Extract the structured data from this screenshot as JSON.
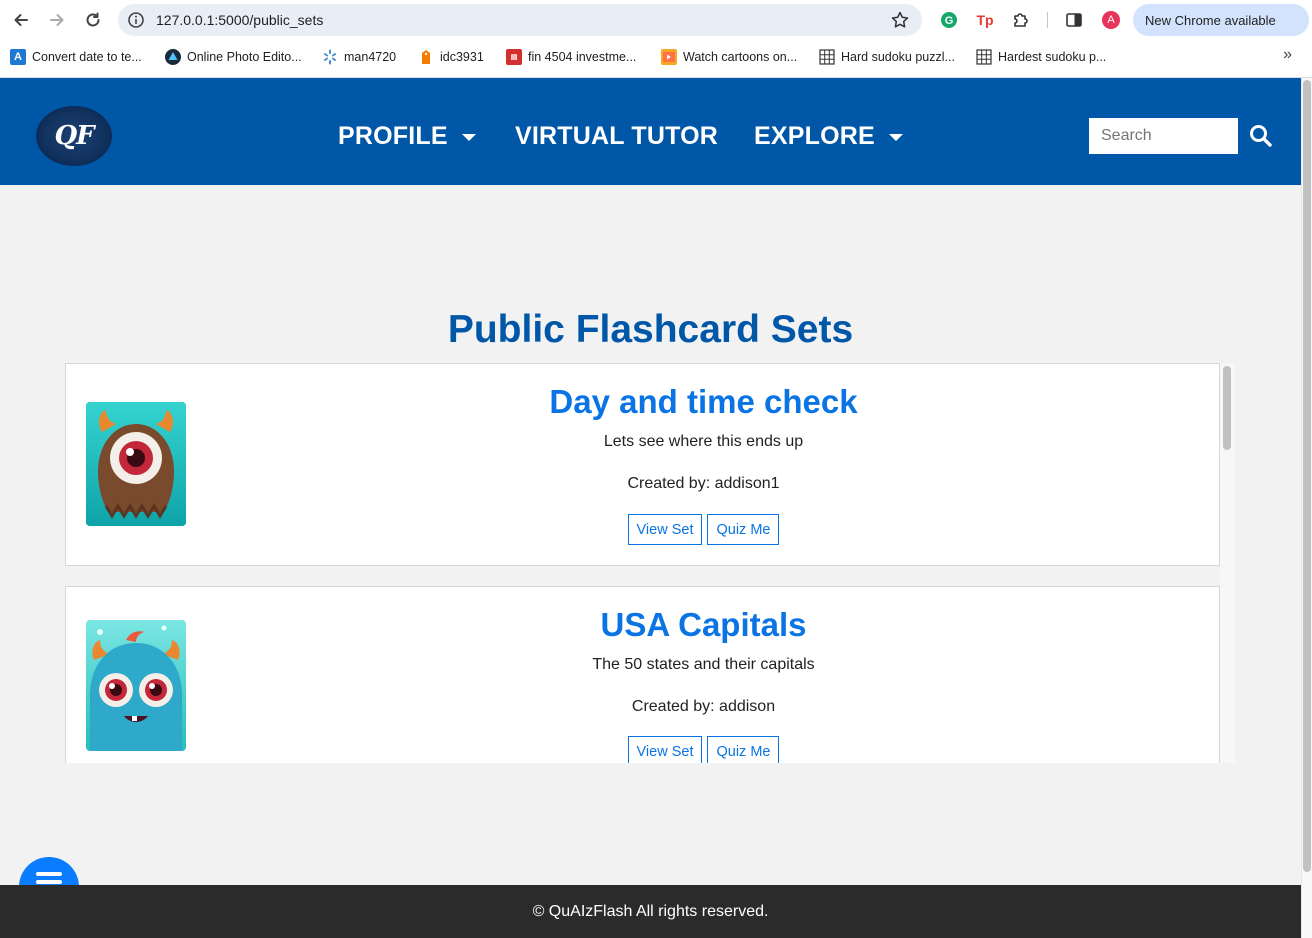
{
  "browser": {
    "url": "127.0.0.1:5000/public_sets",
    "update_label": "New Chrome available",
    "bookmarks": [
      {
        "label": "Convert date to te..."
      },
      {
        "label": "Online Photo Edito..."
      },
      {
        "label": "man4720"
      },
      {
        "label": "idc3931"
      },
      {
        "label": "fin 4504 investme..."
      },
      {
        "label": "Watch cartoons on..."
      },
      {
        "label": "Hard sudoku puzzl..."
      },
      {
        "label": "Hardest sudoku p..."
      }
    ],
    "profile_initial": "A"
  },
  "header": {
    "logo_text": "QF",
    "menu": [
      {
        "label": "PROFILE"
      },
      {
        "label": "VIRTUAL TUTOR"
      },
      {
        "label": "EXPLORE"
      }
    ],
    "search_placeholder": "Search"
  },
  "main": {
    "title": "Public Flashcard Sets",
    "sets": [
      {
        "title": "Day and time check",
        "description": "Lets see where this ends up",
        "author": "Created by: addison1",
        "view_label": "View Set",
        "quiz_label": "Quiz Me"
      },
      {
        "title": "USA Capitals",
        "description": "The 50 states and their capitals",
        "author": "Created by: addison",
        "view_label": "View Set",
        "quiz_label": "Quiz Me"
      }
    ]
  },
  "footer": {
    "text": "© QuAIzFlash All rights reserved."
  },
  "colors": {
    "brand_blue": "#0057a8",
    "link_blue": "#0a74e4",
    "fab_blue": "#0a7cff",
    "footer_bg": "#2b2b2b"
  }
}
